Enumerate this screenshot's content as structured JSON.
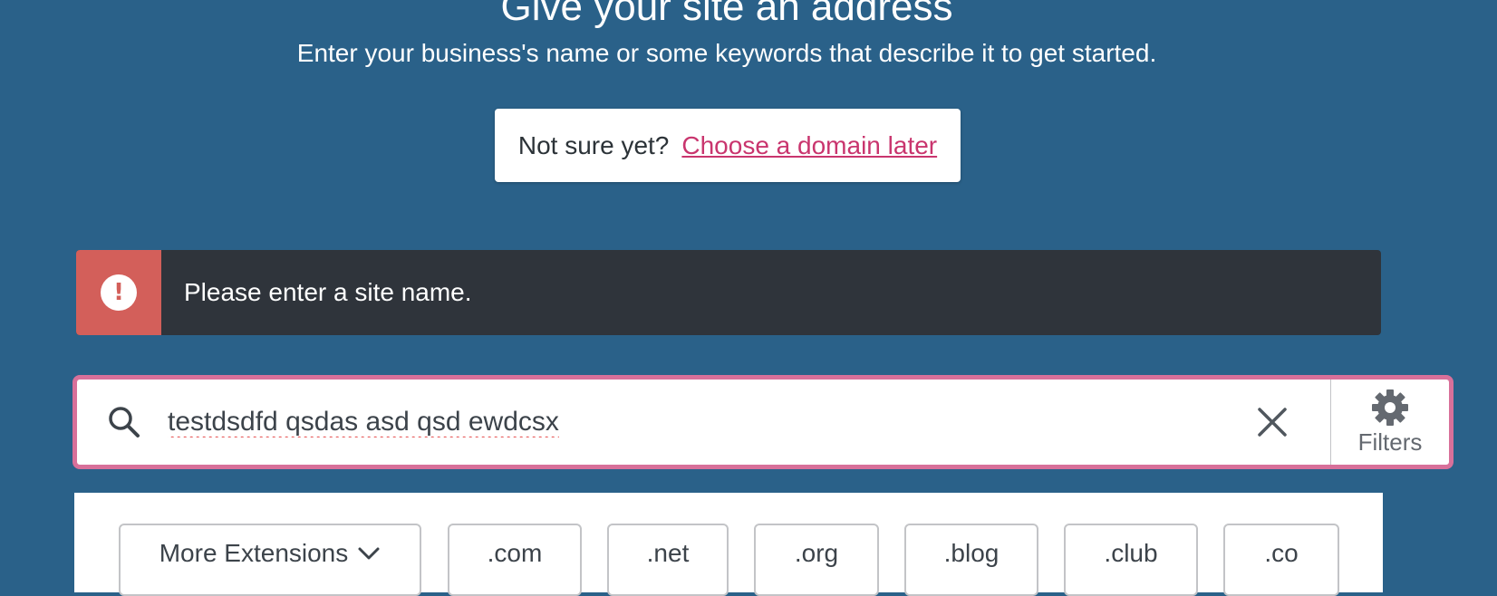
{
  "header": {
    "title": "Give your site an address",
    "subtitle": "Enter your business's name or some keywords that describe it to get started."
  },
  "domain_later": {
    "prompt": "Not sure yet?",
    "link": "Choose a domain later"
  },
  "notice": {
    "icon": "exclamation-icon",
    "icon_glyph": "!",
    "message": "Please enter a site name.",
    "status_color": "#d35f5a"
  },
  "search": {
    "value": "testdsdfd qsdas asd qsd ewdcsx",
    "icons": [
      "search-icon",
      "close-icon",
      "gear-icon"
    ],
    "filters_label": "Filters",
    "focus_border_color": "#d8709a"
  },
  "extensions": {
    "more_label": "More Extensions",
    "items": [
      ".com",
      ".net",
      ".org",
      ".blog",
      ".club",
      ".co"
    ]
  }
}
